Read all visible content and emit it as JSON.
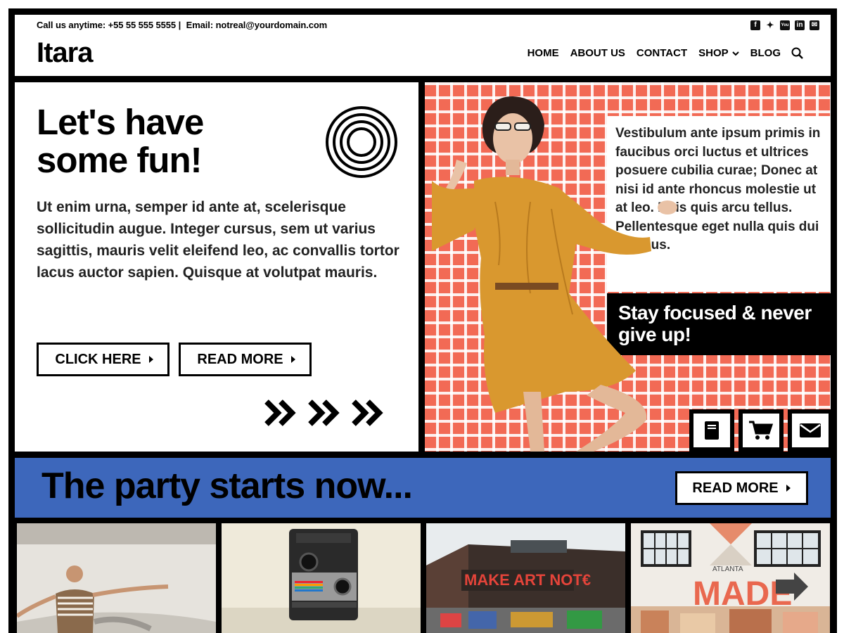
{
  "topbar": {
    "phone_text": "Call us anytime: +55 55 555 5555 |",
    "email_text": "Email: notreal@yourdomain.com"
  },
  "social": [
    "facebook-icon",
    "twitter-icon",
    "youtube-icon",
    "linkedin-icon",
    "email-icon"
  ],
  "site": {
    "logo": "Itara"
  },
  "nav": {
    "home": "HOME",
    "about": "ABOUT US",
    "contact": "CONTACT",
    "shop": "SHOP",
    "blog": "BLOG"
  },
  "hero": {
    "title": "Let's have some fun!",
    "text": "Ut enim urna, semper id ante at, scelerisque sollicitudin augue. Integer cursus, sem ut varius sagittis, mauris velit eleifend leo, ac convallis tortor lacus auctor sapien. Quisque at volutpat mauris.",
    "button_click": "CLICK HERE",
    "button_read": "READ MORE"
  },
  "feature": {
    "quote": "Vestibulum ante ipsum primis in faucibus orci luctus et ultrices posuere cubilia curae; Donec at nisi id ante rhoncus molestie ut at leo. Duis quis arcu tellus. Pellentesque eget nulla quis dui dapibus.",
    "focus": "Stay focused & never give up!"
  },
  "party": {
    "title": "The party starts now...",
    "button": "READ MORE"
  },
  "colors": {
    "accent_blue": "#3d67bb",
    "grid_red": "#f26a55",
    "dress": "#d9982f"
  }
}
